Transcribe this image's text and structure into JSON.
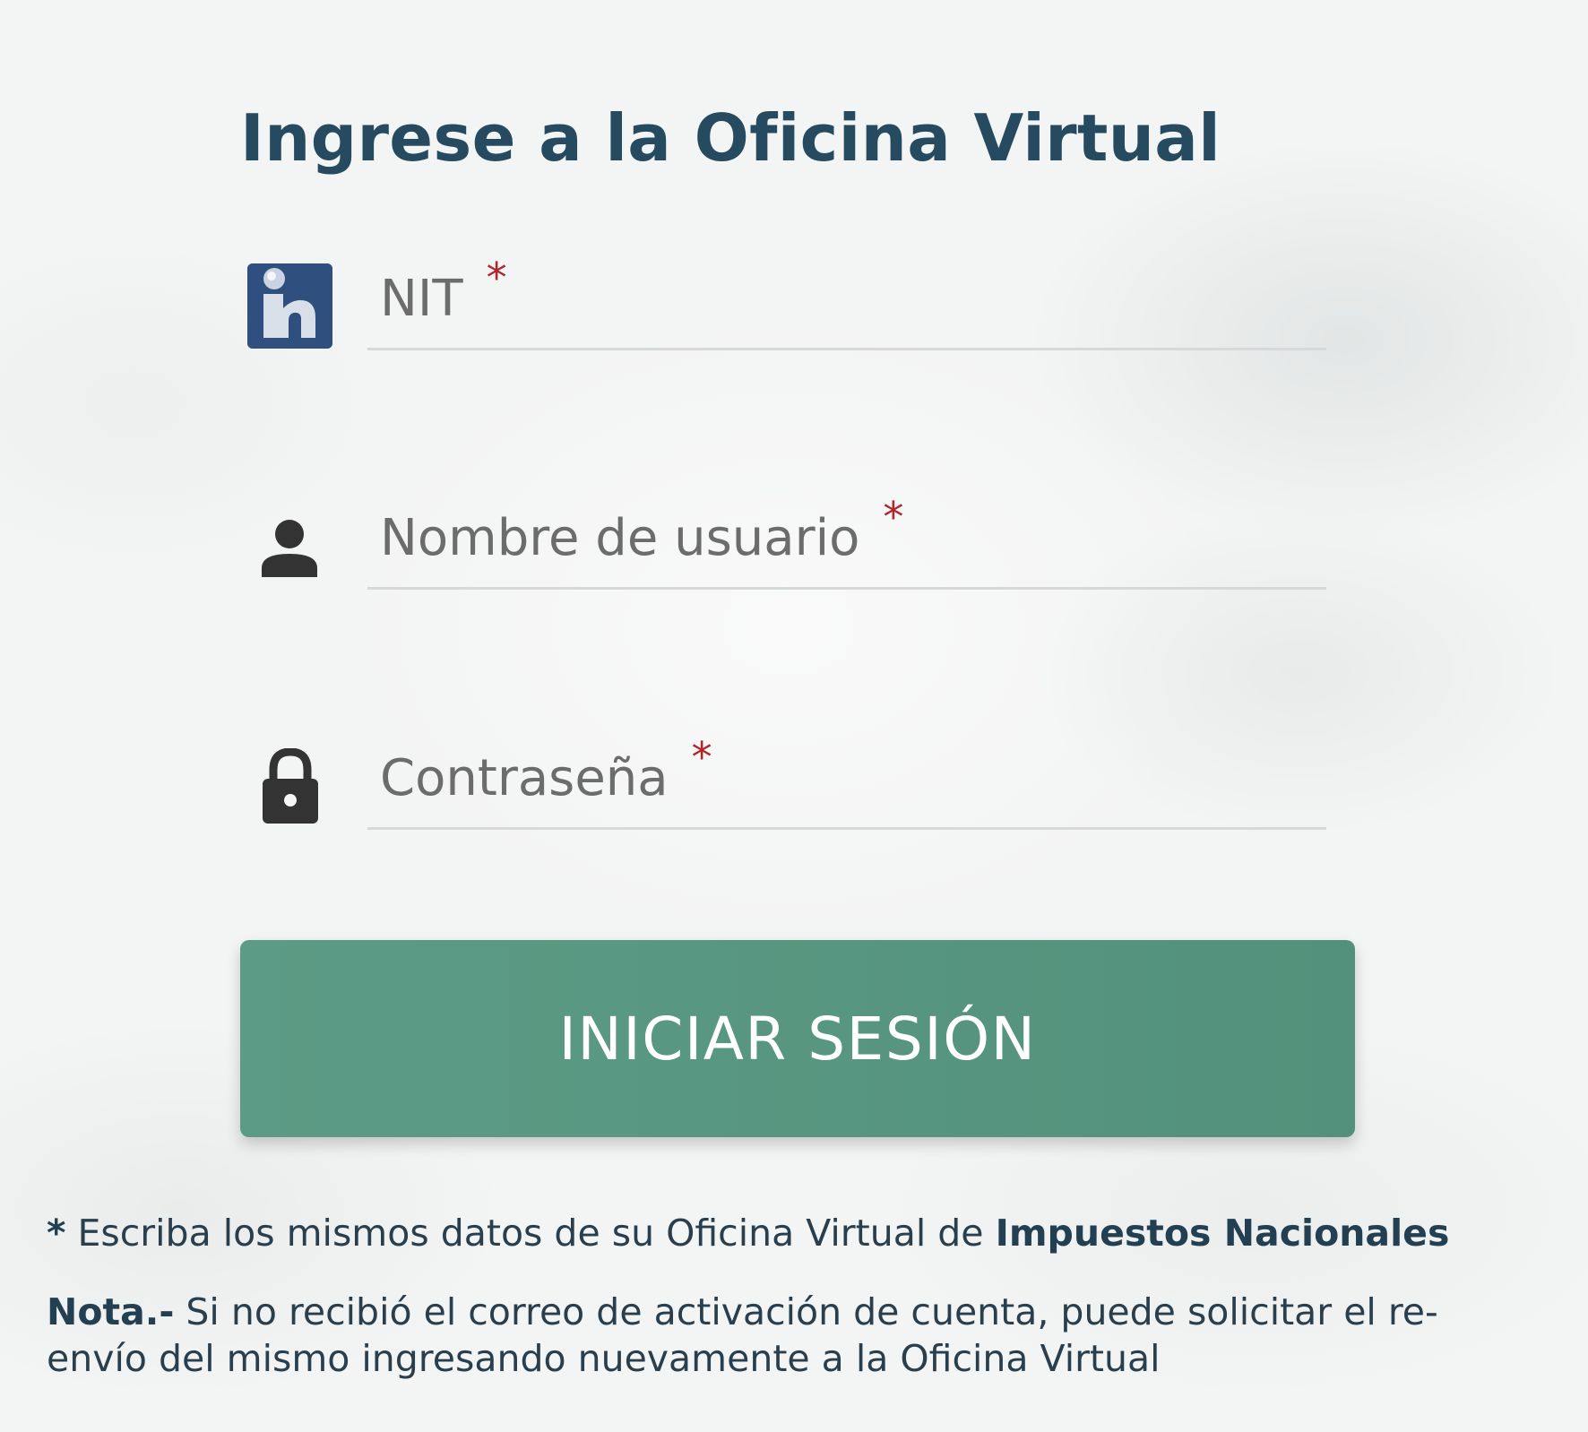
{
  "title": "Ingrese a la Oficina Virtual",
  "fields": {
    "nit": {
      "placeholder": "NIT",
      "required_mark": "*",
      "icon": "impuestos-logo-icon"
    },
    "username": {
      "placeholder": "Nombre de usuario",
      "required_mark": "*",
      "icon": "user-icon"
    },
    "password": {
      "placeholder": "Contraseña",
      "required_mark": "*",
      "icon": "lock-icon"
    }
  },
  "submit_label": "INICIAR SESIÓN",
  "footnote": {
    "marker": "*",
    "text": "Escriba los mismos datos de su Oficina Virtual de",
    "bold": "Impuestos Nacionales"
  },
  "note": {
    "label": "Nota.-",
    "line1": "Si no recibió el correo de activación de cuenta, puede solicitar el re-",
    "line2": "envío del mismo ingresando nuevamente a la Oficina Virtual"
  },
  "colors": {
    "title": "#264a5f",
    "button": "#5a9882",
    "required": "#b0262d",
    "underline": "#d6d8d9"
  }
}
